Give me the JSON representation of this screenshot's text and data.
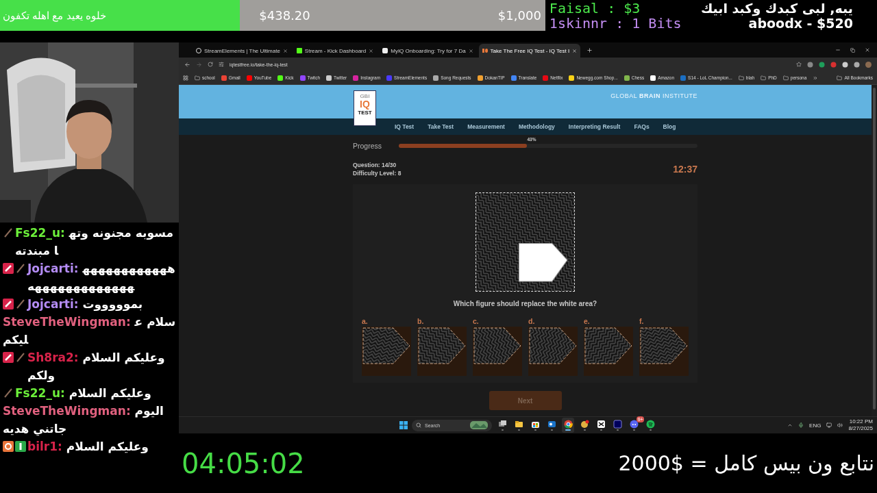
{
  "overlay": {
    "goal": {
      "title": "خلوه يعيد مع اهله تكفون",
      "current": "$438.20",
      "target": "$1,000",
      "level": 0.44
    },
    "recent_events": [
      {
        "text": "Faisal : $3",
        "color": "#4be84b"
      },
      {
        "text": "1skinnr : 1 Bits",
        "color": "#c38df2"
      }
    ],
    "top_donation": {
      "message": "يبه, لبى كبدك وكبد ابيك",
      "donor": "aboodx - $520"
    },
    "uptime": "04:05:02",
    "note": "نتابع ون بيس كامل = $2000"
  },
  "chat": [
    {
      "user": "Fs22_u:",
      "color": "#6cf03a",
      "badges": [
        {
          "kind": "mod"
        }
      ],
      "message": "مسوبه مجنونه وتها مبندته"
    },
    {
      "user": "Jojcarti:",
      "color": "#b48cf5",
      "badges": [
        {
          "kind": "sub"
        },
        {
          "kind": "mod"
        }
      ],
      "message": "هههههههههههههههههههههههههه"
    },
    {
      "user": "Jojcarti:",
      "color": "#b48cf5",
      "badges": [
        {
          "kind": "sub"
        },
        {
          "kind": "mod"
        }
      ],
      "message": "بموووووت"
    },
    {
      "user": "SteveTheWingman:",
      "color": "#e0607e",
      "message": "سلام عليكم"
    },
    {
      "user": "Sh8ra2:",
      "color": "#d8234a",
      "badges": [
        {
          "kind": "sub"
        },
        {
          "kind": "mod"
        }
      ],
      "message": "وعليكم السلام ولكم"
    },
    {
      "user": "Fs22_u:",
      "color": "#6cf03a",
      "badges": [
        {
          "kind": "mod"
        }
      ],
      "message": "وعليكم السلام"
    },
    {
      "user": "SteveTheWingman:",
      "color": "#e0607e",
      "message": "اليوم جاتني هديه"
    },
    {
      "user": "bilr1:",
      "color": "#d8234a",
      "badges": [
        {
          "kind": "og"
        },
        {
          "kind": "first"
        }
      ],
      "message": "وعليكم السلام"
    }
  ],
  "browser": {
    "tabs": [
      {
        "title": "StreamElements | The Ultimate",
        "kind": "streamelements",
        "selected": false
      },
      {
        "title": "Stream - Kick Dashboard",
        "kind": "kick",
        "selected": false
      },
      {
        "title": "MyIQ Onboarding: Try for 7 Da",
        "kind": "myiq",
        "selected": false
      },
      {
        "title": "Take The Free IQ Test - IQ Test I",
        "kind": "iqtest",
        "selected": true
      }
    ],
    "address": "iqtestfree.io/take-the-iq-test",
    "bookmarks": [
      {
        "label": "school",
        "kind": "folder"
      },
      {
        "label": "Gmail",
        "kind": "gmail"
      },
      {
        "label": "YouTube",
        "kind": "youtube"
      },
      {
        "label": "Kick",
        "kind": "kick"
      },
      {
        "label": "Twitch",
        "kind": "twitch"
      },
      {
        "label": "Twitter",
        "kind": "twitter"
      },
      {
        "label": "Instagram",
        "kind": "instagram"
      },
      {
        "label": "StreamElements",
        "kind": "streamelements"
      },
      {
        "label": "Song Requests",
        "kind": "song"
      },
      {
        "label": "DokanTIP",
        "kind": "dokan"
      },
      {
        "label": "Translate",
        "kind": "translate"
      },
      {
        "label": "Netflix",
        "kind": "netflix"
      },
      {
        "label": "Newegg.com Shop...",
        "kind": "newegg"
      },
      {
        "label": "Chess",
        "kind": "chess"
      },
      {
        "label": "Amazon",
        "kind": "amazon"
      },
      {
        "label": "S14 - LoL Champion...",
        "kind": "lol"
      },
      {
        "label": "blah",
        "kind": "folder"
      },
      {
        "label": "PhD",
        "kind": "folder"
      },
      {
        "label": "persona",
        "kind": "folder"
      }
    ],
    "all_bookmarks": "All Bookmarks",
    "page": {
      "logo": {
        "top": "GBI",
        "middle": "IQ",
        "bottom": "TEST"
      },
      "brand": "GLOBAL **BRAIN** INSTITUTE",
      "nav": [
        "IQ Test",
        "Take Test",
        "Measurement",
        "Methodology",
        "Interpreting Result",
        "FAQs",
        "Blog"
      ],
      "progress": {
        "label": "Progress",
        "level": 0.43,
        "reading": "43%"
      },
      "question": "Question: 14/30",
      "difficulty": "Difficulty Level: 8",
      "timer": "12:37",
      "prompt": "Which figure should replace the white area?",
      "options": [
        {
          "label": "a.",
          "selected": false
        },
        {
          "label": "b.",
          "selected": false
        },
        {
          "label": "c.",
          "selected": false
        },
        {
          "label": "d.",
          "selected": false
        },
        {
          "label": "e.",
          "selected": false
        },
        {
          "label": "f.",
          "selected": false
        }
      ],
      "next_button": {
        "label": "Next",
        "disabled": true
      }
    }
  },
  "taskbar": {
    "search_placeholder": "Search",
    "apps": [
      {
        "kind": "taskview",
        "selected": false
      },
      {
        "kind": "explorer",
        "selected": false
      },
      {
        "kind": "store",
        "selected": false
      },
      {
        "kind": "outlook",
        "selected": false
      },
      {
        "kind": "chrome",
        "selected": true
      },
      {
        "kind": "game",
        "selected": false
      },
      {
        "kind": "capcut",
        "selected": false
      },
      {
        "kind": "premiere",
        "selected": false
      },
      {
        "kind": "discord",
        "selected": false,
        "badge": "9+"
      },
      {
        "kind": "spotify",
        "selected": false
      }
    ],
    "language": "ENG",
    "time": "10:22 PM",
    "date": "8/27/2025"
  }
}
